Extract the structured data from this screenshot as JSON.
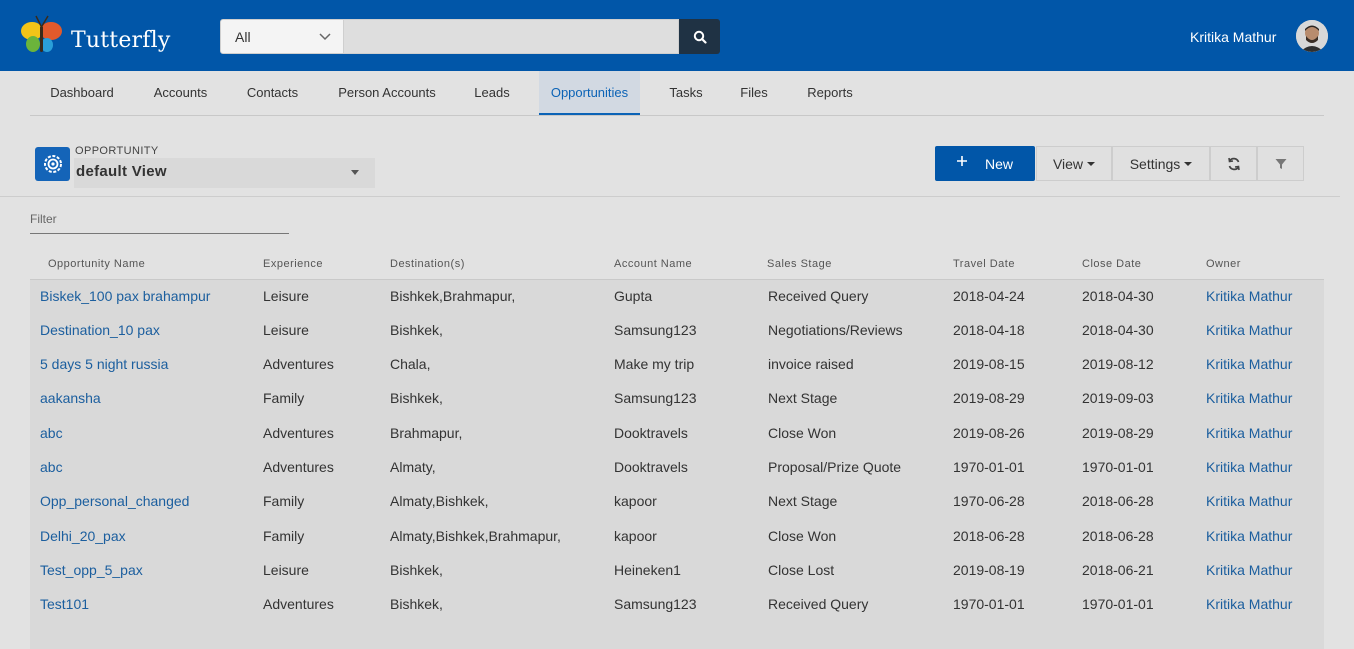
{
  "app": {
    "name": "Tutterfly",
    "user_name": "Kritika Mathur"
  },
  "search": {
    "scope": "All",
    "value": "",
    "placeholder": ""
  },
  "nav": {
    "items": [
      "Dashboard",
      "Accounts",
      "Contacts",
      "Person Accounts",
      "Leads",
      "Opportunities",
      "Tasks",
      "Files",
      "Reports"
    ],
    "active": "Opportunities"
  },
  "page": {
    "object_label": "OPPORTUNITY",
    "view_name": "default View",
    "filter_placeholder": "Filter"
  },
  "toolbar": {
    "new_label": "New",
    "view_label": "View",
    "settings_label": "Settings"
  },
  "table": {
    "columns": [
      "Opportunity Name",
      "Experience",
      "Destination(s)",
      "Account Name",
      "Sales Stage",
      "Travel Date",
      "Close Date",
      "Owner"
    ],
    "rows": [
      [
        "Biskek_100 pax brahampur",
        "Leisure",
        "Bishkek,Brahmapur,",
        "Gupta",
        "Received Query",
        "2018-04-24",
        "2018-04-30",
        "Kritika Mathur"
      ],
      [
        "Destination_10 pax",
        "Leisure",
        "Bishkek,",
        "Samsung123",
        "Negotiations/Reviews",
        "2018-04-18",
        "2018-04-30",
        "Kritika Mathur"
      ],
      [
        "5 days 5 night russia",
        "Adventures",
        "Chala,",
        "Make my trip",
        "invoice raised",
        "2019-08-15",
        "2019-08-12",
        "Kritika Mathur"
      ],
      [
        "aakansha",
        "Family",
        "Bishkek,",
        "Samsung123",
        "Next Stage",
        "2019-08-29",
        "2019-09-03",
        "Kritika Mathur"
      ],
      [
        "abc",
        "Adventures",
        "Brahmapur,",
        "Dooktravels",
        "Close Won",
        "2019-08-26",
        "2019-08-29",
        "Kritika Mathur"
      ],
      [
        "abc",
        "Adventures",
        "Almaty,",
        "Dooktravels",
        "Proposal/Prize Quote",
        "1970-01-01",
        "1970-01-01",
        "Kritika Mathur"
      ],
      [
        "Opp_personal_changed",
        "Family",
        "Almaty,Bishkek,",
        "kapoor",
        "Next Stage",
        "1970-06-28",
        "2018-06-28",
        "Kritika Mathur"
      ],
      [
        "Delhi_20_pax",
        "Family",
        "Almaty,Bishkek,Brahmapur,",
        "kapoor",
        "Close Won",
        "2018-06-28",
        "2018-06-28",
        "Kritika Mathur"
      ],
      [
        "Test_opp_5_pax",
        "Leisure",
        "Bishkek,",
        "Heineken1",
        "Close Lost",
        "2019-08-19",
        "2018-06-21",
        "Kritika Mathur"
      ],
      [
        "Test101",
        "Adventures",
        "Bishkek,",
        "Samsung123",
        "Received Query",
        "1970-01-01",
        "1970-01-01",
        "Kritika Mathur"
      ]
    ]
  },
  "colors": {
    "header_bg": "#0156a8",
    "link": "#1b5e9e",
    "accent": "#0b63b6"
  },
  "icons": {
    "logo": "butterfly-logo",
    "search": "search-icon",
    "object": "gear-icon",
    "new": "plus-icon",
    "refresh": "refresh-icon",
    "filter": "filter-icon"
  }
}
